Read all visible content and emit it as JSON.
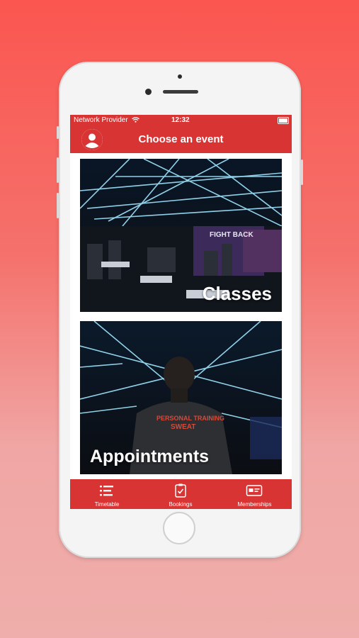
{
  "status_bar": {
    "carrier": "Network Provider",
    "time": "12:32"
  },
  "nav": {
    "title": "Choose an event",
    "avatar_icon": "user-avatar-icon"
  },
  "cards": [
    {
      "label": "Classes"
    },
    {
      "label": "Appointments"
    }
  ],
  "shirt_text": {
    "line1": "PERSONAL TRAINING",
    "line2": "SWEAT"
  },
  "wall_text": "FIGHT BACK",
  "tabs": [
    {
      "label": "Timetable",
      "icon": "list-icon"
    },
    {
      "label": "Bookings",
      "icon": "clipboard-check-icon"
    },
    {
      "label": "Memberships",
      "icon": "id-card-icon"
    }
  ],
  "colors": {
    "accent": "#d93434",
    "background_top": "#fb5650",
    "background_bottom": "#efaeab"
  }
}
